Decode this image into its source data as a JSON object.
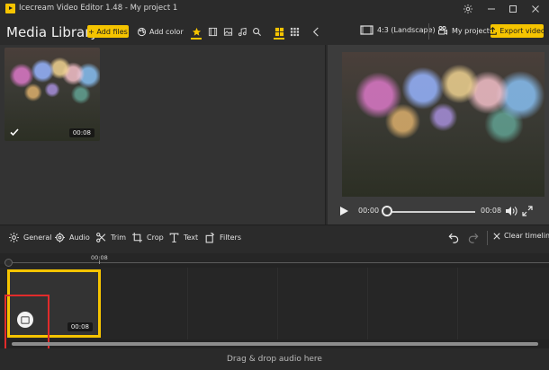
{
  "app": {
    "title": "Icecream Video Editor 1.48 - My project 1"
  },
  "window_controls": {
    "settings_icon": "gear-icon",
    "minimize_icon": "minimize-icon",
    "maximize_icon": "maximize-icon",
    "close_icon": "close-icon"
  },
  "library": {
    "title": "Media Library",
    "add_files_label": "+ Add files",
    "add_color_label": "Add color",
    "filter_icons": [
      "star-icon",
      "film-icon",
      "image-icon",
      "music-icon",
      "search-icon"
    ],
    "view_icons": [
      "grid-large-icon",
      "grid-small-icon"
    ],
    "items": [
      {
        "duration": "00:08",
        "selected": true
      }
    ]
  },
  "preview": {
    "aspect_label": "4:3 (Landscape)",
    "projects_label": "My projects",
    "export_label": "Export video",
    "time_current": "00:00",
    "time_total": "00:08",
    "progress": 0
  },
  "tools": {
    "items": [
      {
        "label": "General",
        "icon": "gear-icon"
      },
      {
        "label": "Audio",
        "icon": "audio-gear-icon"
      },
      {
        "label": "Trim",
        "icon": "scissors-icon"
      },
      {
        "label": "Crop",
        "icon": "crop-icon"
      },
      {
        "label": "Text",
        "icon": "text-icon"
      },
      {
        "label": "Filters",
        "icon": "filters-icon"
      }
    ],
    "clear_label": "Clear timeline"
  },
  "timeline": {
    "ruler_label": "00:08",
    "clip_duration": "00:08",
    "audio_drop_label": "Drag & drop audio here"
  },
  "colors": {
    "accent": "#f5c400",
    "highlight": "#e12b2b"
  }
}
